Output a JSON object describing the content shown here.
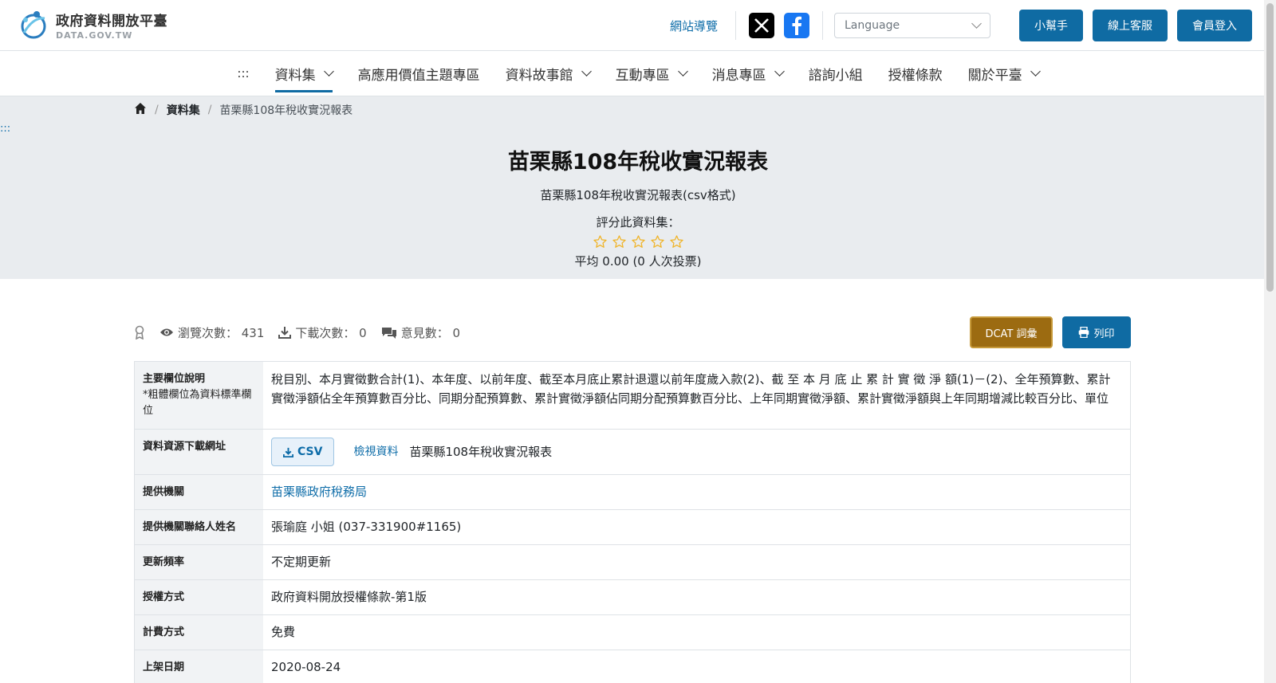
{
  "header": {
    "logo_title": "政府資料開放平臺",
    "logo_sub": "DATA.GOV.TW",
    "sitemap_link": "網站導覽",
    "language_placeholder": "Language",
    "buttons": [
      "小幫手",
      "線上客服",
      "會員登入"
    ]
  },
  "nav": {
    "accesskey": ":::",
    "items": [
      {
        "label": "資料集",
        "has_menu": true,
        "active": true
      },
      {
        "label": "高應用價值主題專區",
        "has_menu": false
      },
      {
        "label": "資料故事館",
        "has_menu": true
      },
      {
        "label": "互動專區",
        "has_menu": true
      },
      {
        "label": "消息專區",
        "has_menu": true
      },
      {
        "label": "諮詢小組",
        "has_menu": false
      },
      {
        "label": "授權條款",
        "has_menu": false
      },
      {
        "label": "關於平臺",
        "has_menu": true
      }
    ]
  },
  "breadcrumb": {
    "level1": "資料集",
    "current": "苗栗縣108年稅收實況報表"
  },
  "hero": {
    "accesskey": ":::",
    "title": "苗栗縣108年稅收實況報表",
    "description": "苗栗縣108年稅收實況報表(csv格式)",
    "rate_label": "評分此資料集：",
    "star_count": 5,
    "rating_value": 0,
    "average": "平均 0.00 (0 人次投票)"
  },
  "stats": {
    "views": "瀏覽次數： 431",
    "downloads": "下載次數： 0",
    "comments": "意見數： 0",
    "dcat_button": "DCAT 詞彙",
    "print_button": "列印"
  },
  "info": {
    "fields_label": "主要欄位說明",
    "fields_note": "*粗體欄位為資料標準欄位",
    "fields_value": "稅目別、本月實徵數合計(1)、本年度、以前年度、截至本月底止累計退還以前年度歲入款(2)、截 至 本 月 底 止 累 計 實 徵 淨 額(1)－(2)、全年預算數、累計實徵淨額佔全年預算數百分比、同期分配預算數、累計實徵淨額佔同期分配預算數百分比、上年同期實徵淨額、累計實徵淨額與上年同期增減比較百分比、單位",
    "resource_label": "資料資源下載網址",
    "resource_format": "CSV",
    "resource_view": "檢視資料",
    "resource_name": "苗栗縣108年稅收實況報表",
    "provider_label": "提供機關",
    "provider_value": "苗栗縣政府稅務局",
    "contact_label": "提供機關聯絡人姓名",
    "contact_value": "張瑜庭 小姐 (037-331900#1165)",
    "frequency_label": "更新頻率",
    "frequency_value": "不定期更新",
    "license_label": "授權方式",
    "license_value": "政府資料開放授權條款-第1版",
    "fee_label": "計費方式",
    "fee_value": "免費",
    "date_label": "上架日期",
    "date_value": "2020-08-24"
  },
  "colors": {
    "primary": "#0f6ba3",
    "dcat": "#9c6b11",
    "hero_bg": "#e9ecef",
    "star": "#f0b429"
  }
}
